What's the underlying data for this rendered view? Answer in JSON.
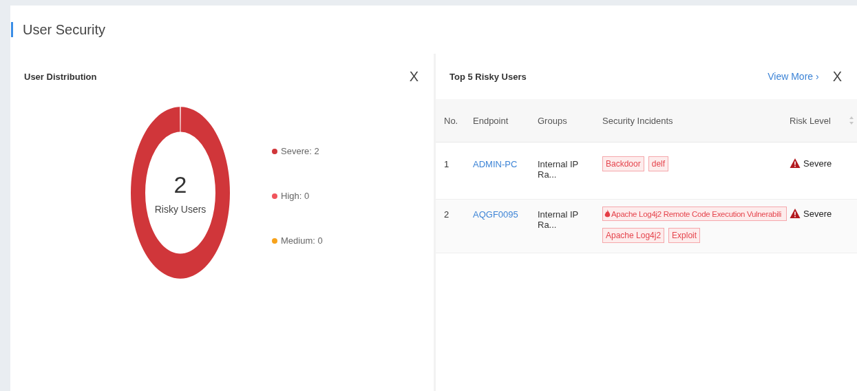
{
  "page_title": "User Security",
  "distribution": {
    "title": "User Distribution",
    "close": "X",
    "total": "2",
    "total_label": "Risky Users",
    "legend": [
      {
        "label": "Severe: 2",
        "color": "#d0363a"
      },
      {
        "label": "High: 0",
        "color": "#f0545c"
      },
      {
        "label": "Medium: 0",
        "color": "#f7a21b"
      }
    ]
  },
  "top_users": {
    "title": "Top 5 Risky Users",
    "view_more": "View More",
    "view_more_arrow": "›",
    "close": "X",
    "columns": [
      "No.",
      "Endpoint",
      "Groups",
      "Security Incidents",
      "Risk Level"
    ],
    "rows": [
      {
        "no": "1",
        "endpoint": "ADMIN-PC",
        "group": "Internal IP Ra...",
        "incidents": [
          {
            "label": "Backdoor",
            "kind": "plain"
          },
          {
            "label": "delf",
            "kind": "plain"
          }
        ],
        "risk": "Severe"
      },
      {
        "no": "2",
        "endpoint": "AQGF0095",
        "group": "Internal IP Ra...",
        "incidents": [
          {
            "label": "Apache Log4j2 Remote Code Execution Vulnerabili",
            "kind": "hot"
          },
          {
            "label": "Apache Log4j2",
            "kind": "plain"
          },
          {
            "label": "Exploit",
            "kind": "plain"
          }
        ],
        "risk": "Severe"
      }
    ]
  }
}
